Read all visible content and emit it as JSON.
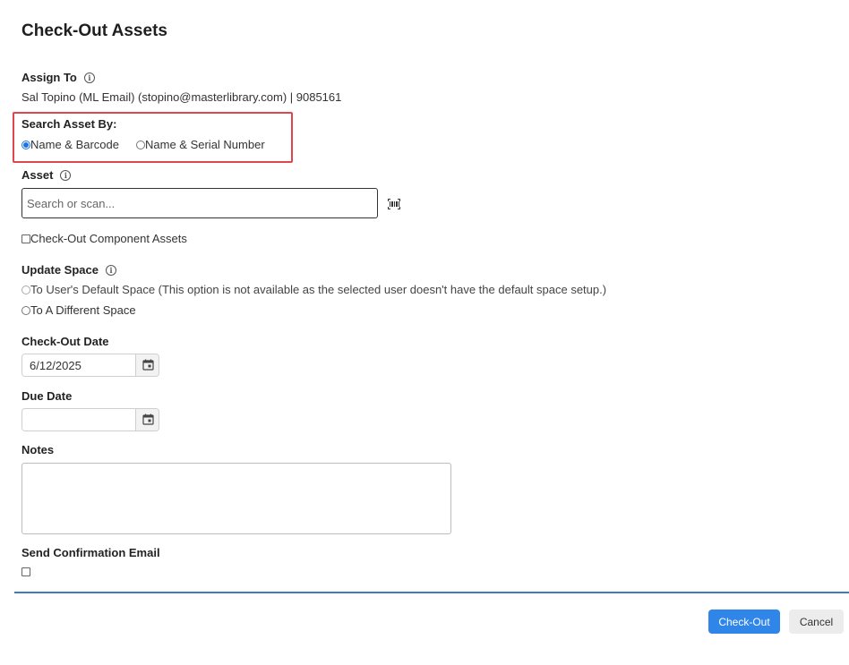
{
  "dialog": {
    "title": "Check-Out Assets"
  },
  "assign_to": {
    "label": "Assign To",
    "value": "Sal Topino (ML Email) (stopino@masterlibrary.com) | 9085161"
  },
  "search_asset_by": {
    "label": "Search Asset By:",
    "options": [
      {
        "label": "Name & Barcode",
        "selected": true
      },
      {
        "label": "Name & Serial Number",
        "selected": false
      }
    ]
  },
  "asset": {
    "label": "Asset",
    "placeholder": "Search or scan...",
    "value": ""
  },
  "component_assets": {
    "label": "Check-Out Component Assets",
    "checked": false
  },
  "update_space": {
    "label": "Update Space",
    "options": [
      {
        "label": "To User's Default Space (This option is not available as the selected user doesn't have the default space setup.)",
        "selected": false,
        "disabled": true
      },
      {
        "label": "To A Different Space",
        "selected": false,
        "disabled": false
      }
    ]
  },
  "checkout_date": {
    "label": "Check-Out Date",
    "value": "6/12/2025"
  },
  "due_date": {
    "label": "Due Date",
    "value": ""
  },
  "notes": {
    "label": "Notes",
    "value": ""
  },
  "send_email": {
    "label": "Send Confirmation Email",
    "checked": false
  },
  "footer": {
    "primary_label": "Check-Out",
    "secondary_label": "Cancel"
  },
  "colors": {
    "primary": "#2f86e8",
    "highlight": "#e0464e",
    "divider": "#3b7bbf"
  },
  "icons": {
    "info": "info-circle-icon",
    "barcode": "barcode-icon",
    "calendar": "calendar-icon"
  }
}
